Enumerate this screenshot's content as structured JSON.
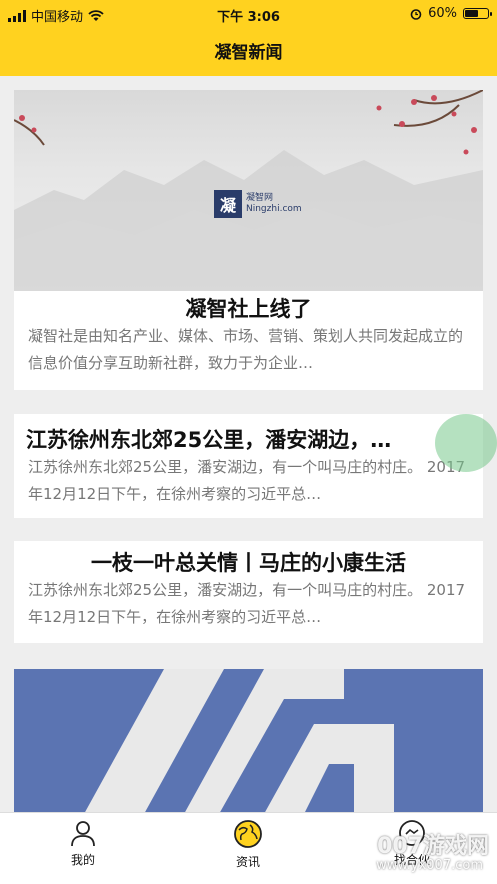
{
  "status_bar": {
    "carrier": "中国移动",
    "time": "下午 3:06",
    "battery": "60%",
    "battery_level": 0.6
  },
  "header": {
    "title": "凝智新闻"
  },
  "articles": [
    {
      "title": "凝智社上线了",
      "summary": "凝智社是由知名产业、媒体、市场、营销、策划人共同发起成立的信息价值分享互助新社群，致力于为企业…",
      "logo_text": "凝智网",
      "logo_sub": "Ningzhi.com"
    },
    {
      "title": "江苏徐州东北郊25公里，潘安湖边，…",
      "summary": "江苏徐州东北郊25公里，潘安湖边，有一个叫马庄的村庄。 2017年12月12日下午，在徐州考察的习近平总…"
    },
    {
      "title": "一枝一叶总关情丨马庄的小康生活",
      "summary": "江苏徐州东北郊25公里，潘安湖边，有一个叫马庄的村庄。 2017年12月12日下午，在徐州考察的习近平总…"
    }
  ],
  "tabbar": {
    "tabs": [
      {
        "label": "我的"
      },
      {
        "label": "资讯"
      },
      {
        "label": "找合伙"
      }
    ]
  },
  "watermark": {
    "line1": "007游戏网",
    "line2": "www.yx007.com"
  }
}
